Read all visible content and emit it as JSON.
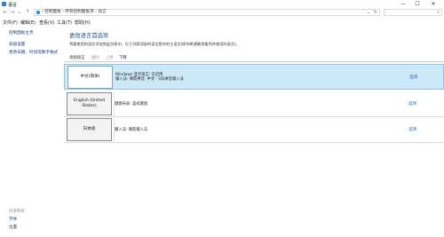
{
  "window": {
    "title": "语言",
    "minimize_glyph": "—",
    "maximize_glyph": "☐",
    "close_glyph": "✕"
  },
  "address": {
    "crumbs": "›  控制面板  ›  所有控制面板项  ›  语言",
    "dropdown_glyph": "⌄",
    "refresh_glyph": "↻",
    "search_icon_glyph": "⌕"
  },
  "nav": {
    "back_glyph": "←",
    "forward_glyph": "→",
    "recent_glyph": "⌄",
    "up_glyph": "↑"
  },
  "menubar": {
    "items": [
      "文件(F)",
      "编辑(E)",
      "查看(V)",
      "工具(T)",
      "帮助(H)"
    ]
  },
  "sidebar": {
    "links": [
      "控制面板主页",
      "高级设置",
      "更改日期、时间或数字格式"
    ],
    "see_also_heading": "另请参阅",
    "see_also_links": [
      "字体",
      "位置"
    ]
  },
  "main": {
    "heading": "更改语言首选项",
    "description": "将要使用的语言添加到此列表中。位于列表顶部的语言是你的主语言(即你希望最常看到并使用的语言)。"
  },
  "toolbar": {
    "add": "添加语言",
    "remove": "删除",
    "up": "上移",
    "down": "下移"
  },
  "languages": [
    {
      "name": "中文(简体)",
      "line1": "Windows 显示语言: 已启用",
      "line2": "输入法: 微软拼音, 中文 - QQ拼音输入法",
      "options": "选项"
    },
    {
      "name": "English (United States)",
      "line1": "键盘布局: 美式键盘",
      "line2": "",
      "options": "选项"
    },
    {
      "name": "日本語",
      "line1": "输入法: 微软输入法",
      "line2": "",
      "options": "选项"
    }
  ]
}
